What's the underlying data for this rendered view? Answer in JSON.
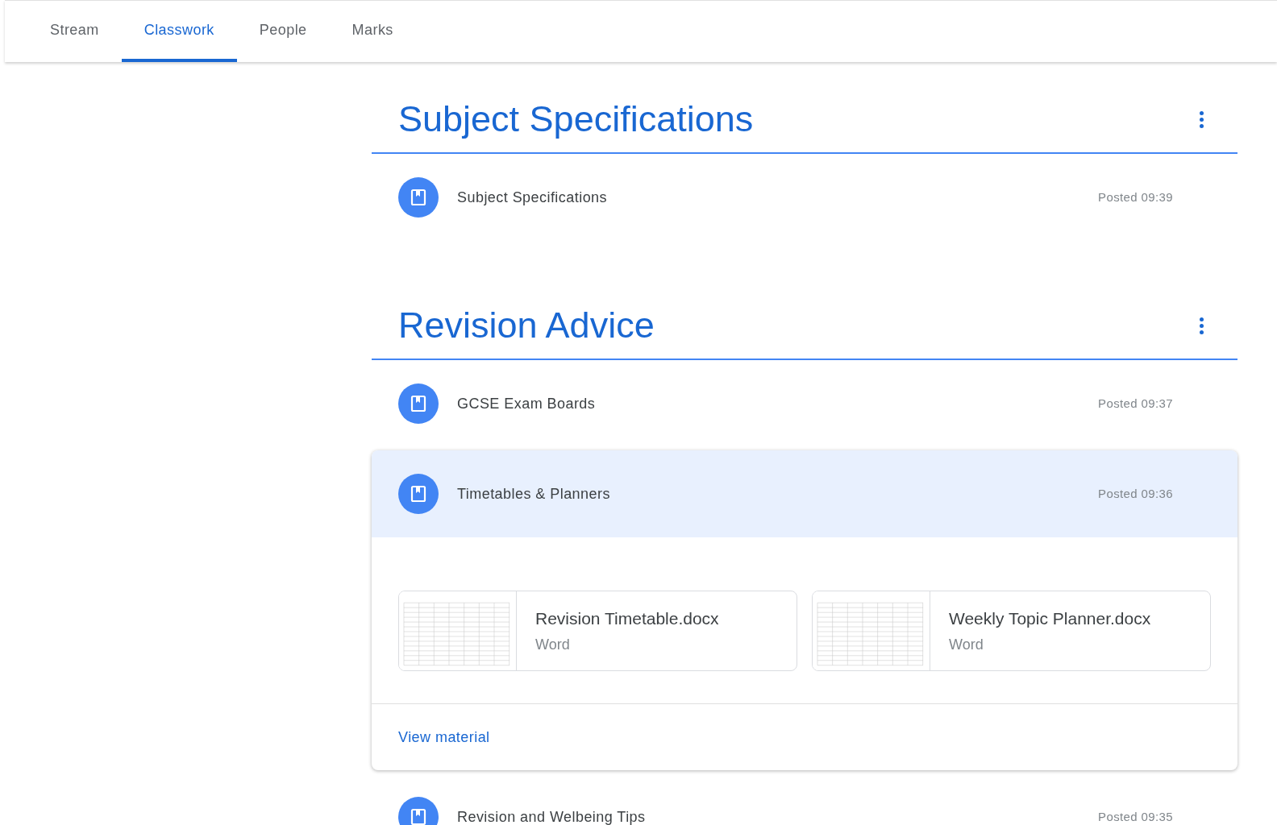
{
  "tabs": [
    {
      "label": "Stream",
      "selected": false
    },
    {
      "label": "Classwork",
      "selected": true
    },
    {
      "label": "People",
      "selected": false
    },
    {
      "label": "Marks",
      "selected": false
    }
  ],
  "topics": [
    {
      "title": "Subject Specifications",
      "materials": [
        {
          "title": "Subject Specifications",
          "posted": "Posted 09:39",
          "expanded": false
        }
      ]
    },
    {
      "title": "Revision Advice",
      "materials": [
        {
          "title": "GCSE Exam Boards",
          "posted": "Posted 09:37",
          "expanded": false
        },
        {
          "title": "Timetables & Planners",
          "posted": "Posted 09:36",
          "expanded": true,
          "attachments": [
            {
              "name": "Revision Timetable.docx",
              "type": "Word"
            },
            {
              "name": "Weekly Topic Planner.docx",
              "type": "Word"
            }
          ],
          "link": "View material"
        },
        {
          "title": "Revision and Welbeing Tips",
          "posted": "Posted 09:35",
          "expanded": false
        }
      ]
    }
  ]
}
